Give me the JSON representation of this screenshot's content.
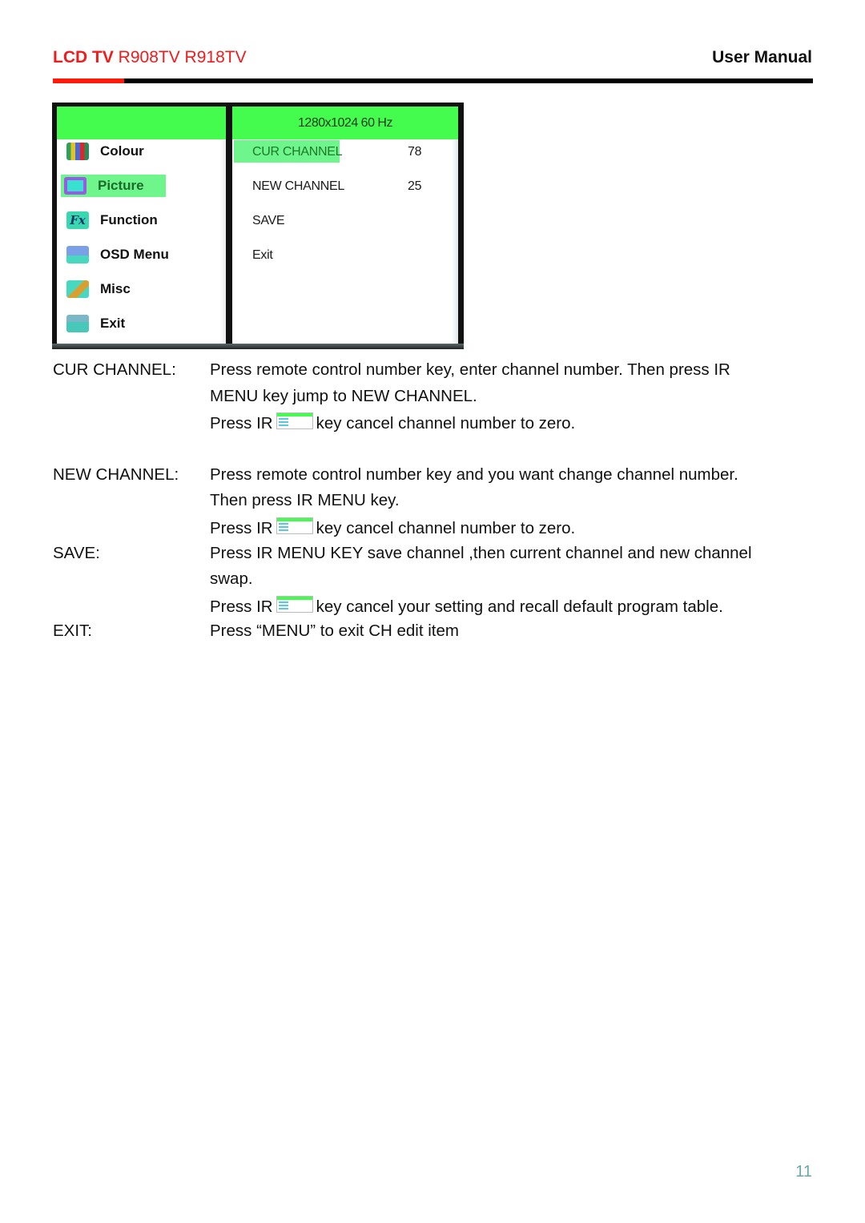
{
  "header": {
    "brand": "LCD TV",
    "models": "R908TV R918TV",
    "doc_type": "User Manual",
    "accent_color": "#ee1c1c"
  },
  "osd": {
    "resolution": "1280x1024  60 Hz",
    "menu": [
      {
        "label": "Colour",
        "icon": "colour-bars-icon",
        "selected": false
      },
      {
        "label": "Picture",
        "icon": "picture-icon",
        "selected": true
      },
      {
        "label": "Function",
        "icon": "function-fx-icon",
        "selected": false
      },
      {
        "label": "OSD Menu",
        "icon": "osd-menu-icon",
        "selected": false
      },
      {
        "label": "Misc",
        "icon": "misc-icon",
        "selected": false
      },
      {
        "label": "Exit",
        "icon": "exit-icon",
        "selected": false
      }
    ],
    "submenu": [
      {
        "label": "CUR  CHANNEL",
        "value": "78",
        "selected": true
      },
      {
        "label": "NEW  CHANNEL",
        "value": "25",
        "selected": false
      },
      {
        "label": "SAVE",
        "value": "",
        "selected": false
      },
      {
        "label": "Exit",
        "value": "",
        "selected": false
      }
    ],
    "highlight_color": "#43fc4d"
  },
  "instructions": [
    {
      "term": "CUR CHANNEL:",
      "lines": [
        "Press remote control number key, enter channel number. Then press IR",
        "MENU key jump to NEW CHANNEL.",
        {
          "before": "Press IR",
          "after": "key cancel channel number to zero."
        }
      ]
    },
    {
      "term": "NEW CHANNEL:",
      "lines": [
        "Press remote control number key and you want change channel number.",
        "Then press IR MENU key.",
        {
          "before": "Press IR",
          "after": "key cancel channel number to zero."
        }
      ]
    },
    {
      "term": "SAVE:",
      "lines": [
        "Press IR MENU KEY save channel ,then current channel and new channel",
        "swap.",
        {
          "before": "Press IR",
          "after": "key cancel your setting and recall default program table."
        }
      ]
    },
    {
      "term": "EXIT:",
      "lines": [
        "Press “MENU” to exit CH edit item"
      ]
    }
  ],
  "footer": {
    "page_number": "11"
  }
}
